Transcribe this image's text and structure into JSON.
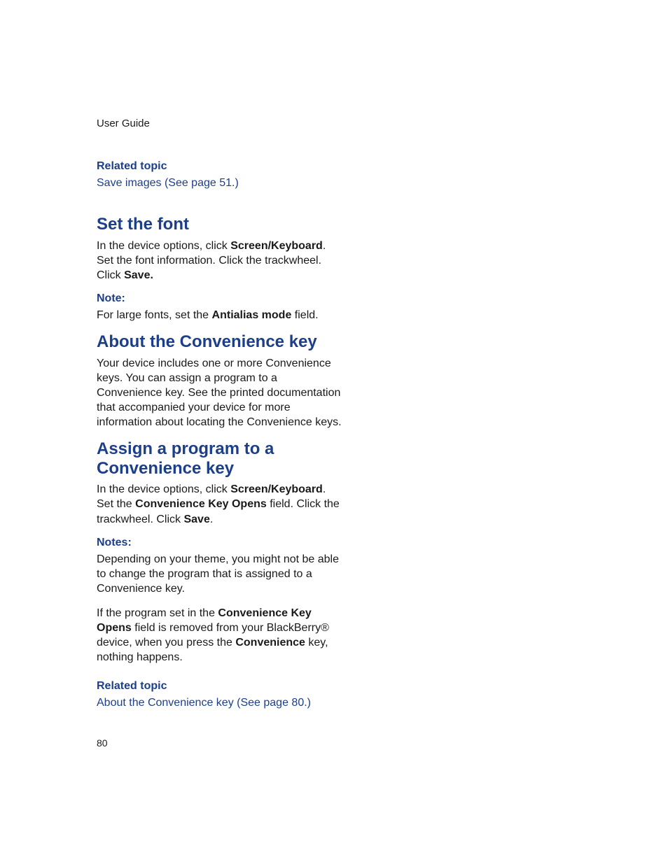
{
  "header": "User Guide",
  "rel1": {
    "heading": "Related topic",
    "link": "Save images (See page 51.)"
  },
  "sec1": {
    "title": "Set the font",
    "p1a": "In the device options, click ",
    "p1b": "Screen/Keyboard",
    "p1c": ". Set the font information. Click the trackwheel. Click ",
    "p1d": "Save.",
    "noteLabel": "Note:",
    "n1a": "For large fonts, set the ",
    "n1b": "Antialias mode",
    "n1c": " field."
  },
  "sec2": {
    "title": "About the Convenience key",
    "p1": "Your device includes one or more Convenience keys. You can assign a program to a Convenience key. See the printed documentation that accompanied your device for more information about locating the Convenience keys."
  },
  "sec3": {
    "title": "Assign a program to a Convenience key",
    "p1a": "In the device options, click ",
    "p1b": "Screen/Keyboard",
    "p1c": ". Set the ",
    "p1d": "Convenience Key Opens",
    "p1e": " field. Click the trackwheel. Click ",
    "p1f": "Save",
    "p1g": ".",
    "notesLabel": "Notes:",
    "n1": "Depending on your theme, you might not be able to change the program that is assigned to a Convenience key.",
    "n2a": "If the program set in the ",
    "n2b": "Convenience Key Opens",
    "n2c": " field is removed from your BlackBerry® device, when you press the ",
    "n2d": "Convenience",
    "n2e": " key, nothing happens."
  },
  "rel2": {
    "heading": "Related topic",
    "link": "About the Convenience key (See page 80.)"
  },
  "pageNumber": "80"
}
